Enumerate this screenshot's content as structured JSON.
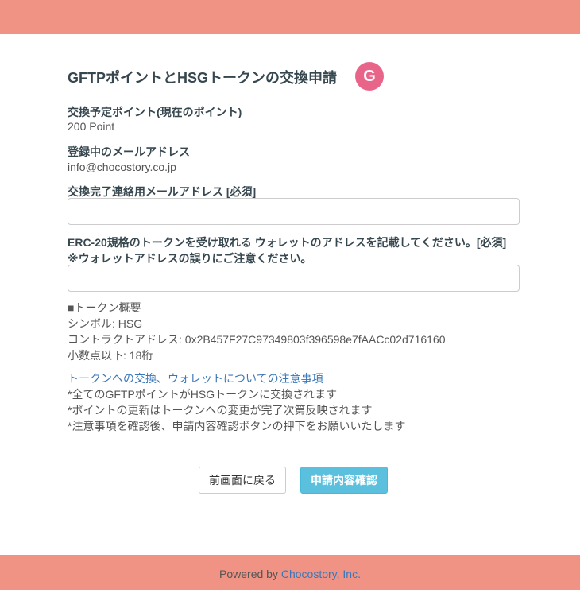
{
  "title": "GFTPポイントとHSGトークンの交換申請",
  "logo_letter": "G",
  "points": {
    "label": "交換予定ポイント(現在のポイント)",
    "value": "200 Point"
  },
  "email": {
    "label": "登録中のメールアドレス",
    "value": "info@chocostory.co.jp"
  },
  "contact_email": {
    "label": "交換完了連絡用メールアドレス [必須]",
    "value": "",
    "placeholder": ""
  },
  "wallet": {
    "label": "ERC-20規格のトークンを受け取れる ウォレットのアドレスを記載してください。[必須]",
    "note": "※ウォレットアドレスの誤りにご注意ください。",
    "value": ""
  },
  "token": {
    "heading": "■トークン概要",
    "symbol": "シンボル: HSG",
    "contract": "コントラクトアドレス: 0x2B457F27C97349803f396598e7fAACc02d716160",
    "decimals": "小数点以下: 18桁"
  },
  "notes": {
    "link": "トークンへの交換、ウォレットについての注意事項",
    "items": [
      "*全てのGFTPポイントがHSGトークンに交換されます",
      "*ポイントの更新はトークンへの変更が完了次第反映されます",
      "*注意事項を確認後、申請内容確認ボタンの押下をお願いいたします"
    ]
  },
  "buttons": {
    "back": "前画面に戻る",
    "confirm": "申請内容確認"
  },
  "footer": {
    "prefix": "Powered by ",
    "company": "Chocostory, Inc."
  },
  "colors": {
    "header": "#f09384",
    "accent": "#5bc0de",
    "link": "#3a77b8",
    "logo": "#e96489"
  }
}
